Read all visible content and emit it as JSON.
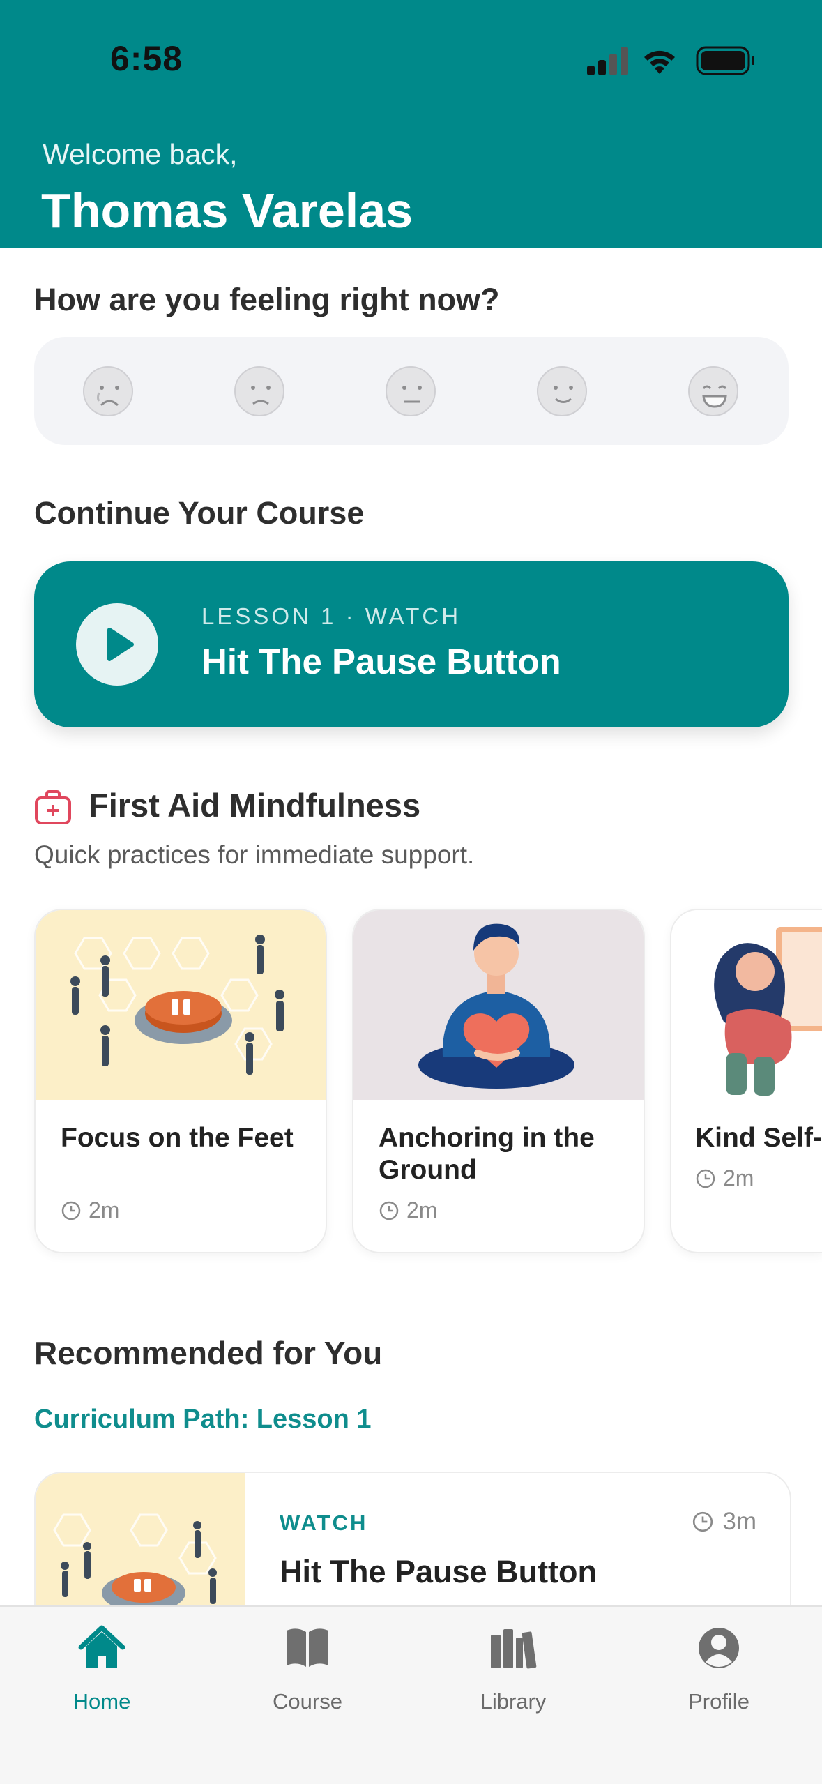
{
  "colors": {
    "brand": "#00898a",
    "header_bg": "#00898a",
    "accent_red": "#e0475d",
    "muted": "#8a8a8a"
  },
  "status_bar": {
    "time": "6:58",
    "icons": [
      "signal-icon",
      "wifi-icon",
      "battery-icon"
    ]
  },
  "header": {
    "welcome": "Welcome back,",
    "user_name": "Thomas Varelas"
  },
  "mood": {
    "question": "How are you feeling right now?",
    "options": [
      "crying-face",
      "slightly-frowning-face",
      "neutral-face",
      "slightly-smiling-face",
      "grinning-face"
    ]
  },
  "continue_course": {
    "heading": "Continue Your Course",
    "lesson_meta": "LESSON 1 · WATCH",
    "lesson_title": "Hit The Pause Button",
    "icon": "play-icon"
  },
  "first_aid": {
    "icon": "first-aid-kit-icon",
    "title": "First Aid Mindfulness",
    "subtitle": "Quick practices for immediate support.",
    "cards": [
      {
        "title": "Focus on the Feet",
        "duration": "2m"
      },
      {
        "title": "Anchoring in the Ground",
        "duration": "2m"
      },
      {
        "title": "Kind Self-",
        "duration": "2m"
      }
    ]
  },
  "recommended": {
    "heading": "Recommended for You",
    "path_link": "Curriculum Path: Lesson 1",
    "item": {
      "kind": "WATCH",
      "duration": "3m",
      "title": "Hit The Pause Button"
    }
  },
  "tabbar": {
    "tabs": [
      {
        "label": "Home",
        "icon": "home-icon",
        "active": true
      },
      {
        "label": "Course",
        "icon": "book-icon",
        "active": false
      },
      {
        "label": "Library",
        "icon": "library-icon",
        "active": false
      },
      {
        "label": "Profile",
        "icon": "profile-icon",
        "active": false
      }
    ]
  }
}
